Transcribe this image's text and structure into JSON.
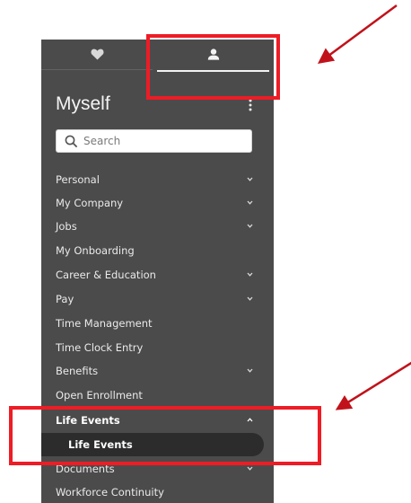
{
  "sidebar": {
    "title": "Myself",
    "search": {
      "placeholder": "Search",
      "value": ""
    },
    "items": [
      {
        "label": "Personal",
        "chevron": "down"
      },
      {
        "label": "My Company",
        "chevron": "down"
      },
      {
        "label": "Jobs",
        "chevron": "down"
      },
      {
        "label": "My Onboarding"
      },
      {
        "label": "Career & Education",
        "chevron": "down"
      },
      {
        "label": "Pay",
        "chevron": "down"
      },
      {
        "label": "Time Management"
      },
      {
        "label": "Time Clock Entry"
      },
      {
        "label": "Benefits",
        "chevron": "down"
      },
      {
        "label": "Open Enrollment"
      },
      {
        "label": "Life Events",
        "chevron": "up",
        "expanded": true
      },
      {
        "label": "Documents",
        "chevron": "down"
      },
      {
        "label": "Workforce Continuity"
      }
    ],
    "active_subitem": "Life Events"
  },
  "tabs": [
    {
      "icon": "heart-icon",
      "active": false
    },
    {
      "icon": "person-icon",
      "active": true
    }
  ],
  "colors": {
    "panel_bg": "#4b4b4b",
    "active_subitem_bg": "#2c2c2c",
    "annotation": "#ee1c25",
    "arrow": "#c1121b"
  }
}
